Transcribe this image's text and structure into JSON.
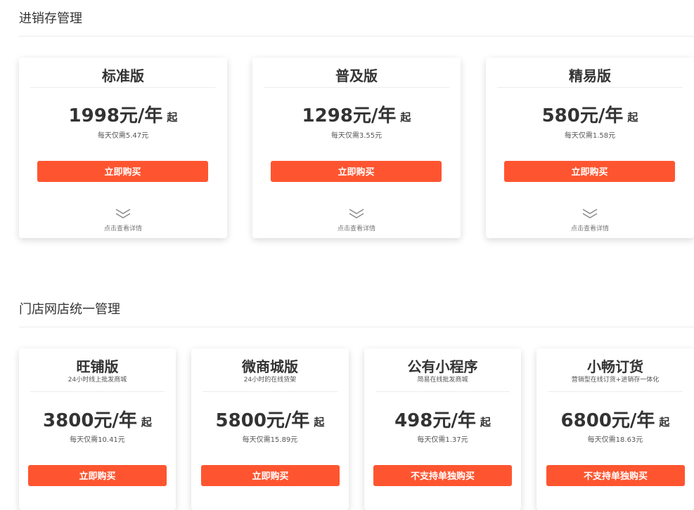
{
  "sections": [
    {
      "title": "进销存管理",
      "cards": [
        {
          "name": "标准版",
          "price": "1998元/年",
          "unit": "起",
          "per_day": "每天仅需5.47元",
          "button": "立即购买",
          "detail": "点击查看详情"
        },
        {
          "name": "普及版",
          "price": "1298元/年",
          "unit": "起",
          "per_day": "每天仅需3.55元",
          "button": "立即购买",
          "detail": "点击查看详情"
        },
        {
          "name": "精易版",
          "price": "580元/年",
          "unit": "起",
          "per_day": "每天仅需1.58元",
          "button": "立即购买",
          "detail": "点击查看详情"
        }
      ]
    },
    {
      "title": "门店网店统一管理",
      "cards": [
        {
          "name": "旺铺版",
          "subtitle": "24小时线上批发商城",
          "price": "3800元/年",
          "unit": "起",
          "per_day": "每天仅需10.41元",
          "button": "立即购买"
        },
        {
          "name": "微商城版",
          "subtitle": "24小时的在线货架",
          "price": "5800元/年",
          "unit": "起",
          "per_day": "每天仅需15.89元",
          "button": "立即购买"
        },
        {
          "name": "公有小程序",
          "subtitle": "简易在线批发商城",
          "price": "498元/年",
          "unit": "起",
          "per_day": "每天仅需1.37元",
          "button": "不支持单独购买"
        },
        {
          "name": "小畅订货",
          "subtitle": "营销型在线订货+进销存一体化",
          "price": "6800元/年",
          "unit": "起",
          "per_day": "每天仅需18.63元",
          "button": "不支持单独购买"
        }
      ]
    }
  ],
  "colors": {
    "accent": "#fe5530",
    "divider": "#ececec",
    "text": "#333333"
  },
  "icons": {
    "expand": "double-chevron-down-icon"
  }
}
